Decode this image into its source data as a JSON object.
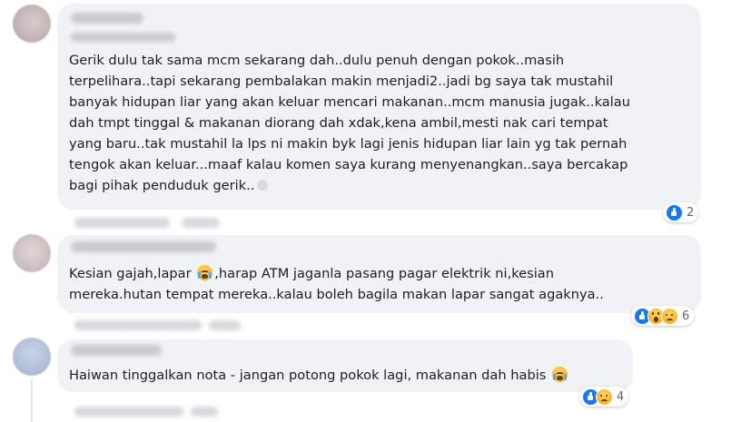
{
  "colors": {
    "bubble": "#f0f2f5",
    "text": "#1c1e21",
    "like_blue": "#1877f2",
    "meta_gray": "#65676b"
  },
  "comments": [
    {
      "author": "",
      "text": "Gerik dulu tak sama mcm sekarang dah..dulu penuh dengan pokok..masih\nterpelihara..tapi sekarang pembalakan makin menjadi2..jadi bg saya tak mustahil\nbanyak hidupan liar yang akan keluar mencari makanan..mcm manusia jugak..kalau\ndah tmpt tinggal & makanan diorang dah xdak,kena ambil,mesti nak cari tempat\nyang baru..tak mustahil la lps ni makin byk lagi jenis hidupan liar lain yg tak pernah\ntengok akan keluar...maaf kalau komen saya kurang menyenangkan..saya bercakap\nbagi pihak penduduk gerik..",
      "reactions": [
        "like-icon"
      ],
      "reaction_count": "2"
    },
    {
      "author": "",
      "text_part1": "Kesian gajah,lapar ",
      "text_part2": ",harap ATM jaganla pasang pagar elektrik ni,kesian",
      "text_line2": "mereka.hutan tempat mereka..kalau boleh bagila makan lapar sangat agaknya..",
      "inline_emoji": "crying-face-icon",
      "reactions": [
        "like-icon",
        "wow-icon",
        "sad-icon"
      ],
      "reaction_count": "6"
    },
    {
      "author": "",
      "text": "Haiwan tinggalkan nota - jangan potong pokok lagi, makanan dah habis ",
      "inline_emoji": "crying-face-icon",
      "reactions": [
        "like-icon",
        "sad-icon"
      ],
      "reaction_count": "4"
    }
  ]
}
